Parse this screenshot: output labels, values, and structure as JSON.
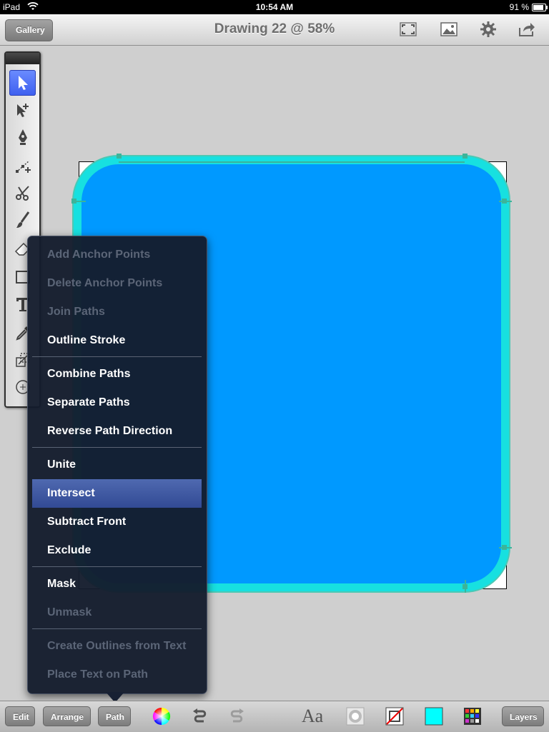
{
  "status_bar": {
    "device": "iPad",
    "time": "10:54 AM",
    "battery": "91 %"
  },
  "nav": {
    "back_label": "Gallery",
    "title": "Drawing 22 @ 58%",
    "icons": [
      "fullscreen-icon",
      "image-icon",
      "gear-icon",
      "share-icon"
    ]
  },
  "tools": [
    "select-arrow-icon",
    "direct-select-icon",
    "pen-icon",
    "add-point-icon",
    "scissors-icon",
    "brush-icon",
    "eraser-icon",
    "rectangle-icon",
    "text-icon",
    "eyedropper-icon",
    "scale-icon",
    "rotate-icon"
  ],
  "shape": {
    "fill": "#0099ff",
    "stroke": "#17e0e0"
  },
  "path_menu": {
    "items": [
      {
        "label": "Add Anchor Points",
        "enabled": false
      },
      {
        "label": "Delete Anchor Points",
        "enabled": false
      },
      {
        "label": "Join Paths",
        "enabled": false
      },
      {
        "label": "Outline Stroke",
        "enabled": true
      },
      {
        "label": "Combine Paths",
        "enabled": true
      },
      {
        "label": "Separate Paths",
        "enabled": true
      },
      {
        "label": "Reverse Path Direction",
        "enabled": true
      },
      {
        "label": "Unite",
        "enabled": true
      },
      {
        "label": "Intersect",
        "enabled": true,
        "highlighted": true
      },
      {
        "label": "Subtract Front",
        "enabled": true
      },
      {
        "label": "Exclude",
        "enabled": true
      },
      {
        "label": "Mask",
        "enabled": true
      },
      {
        "label": "Unmask",
        "enabled": false
      },
      {
        "label": "Create Outlines from Text",
        "enabled": false
      },
      {
        "label": "Place Text on Path",
        "enabled": false
      }
    ]
  },
  "toolbar": {
    "edit_label": "Edit",
    "arrange_label": "Arrange",
    "path_label": "Path",
    "font_label": "Aa",
    "layers_label": "Layers",
    "fill_color": "#00ffff",
    "icons": [
      "color-wheel-icon",
      "undo-icon",
      "redo-icon",
      "font-icon",
      "shadow-icon",
      "stroke-icon",
      "fill-swatch-icon",
      "swatches-icon"
    ]
  }
}
